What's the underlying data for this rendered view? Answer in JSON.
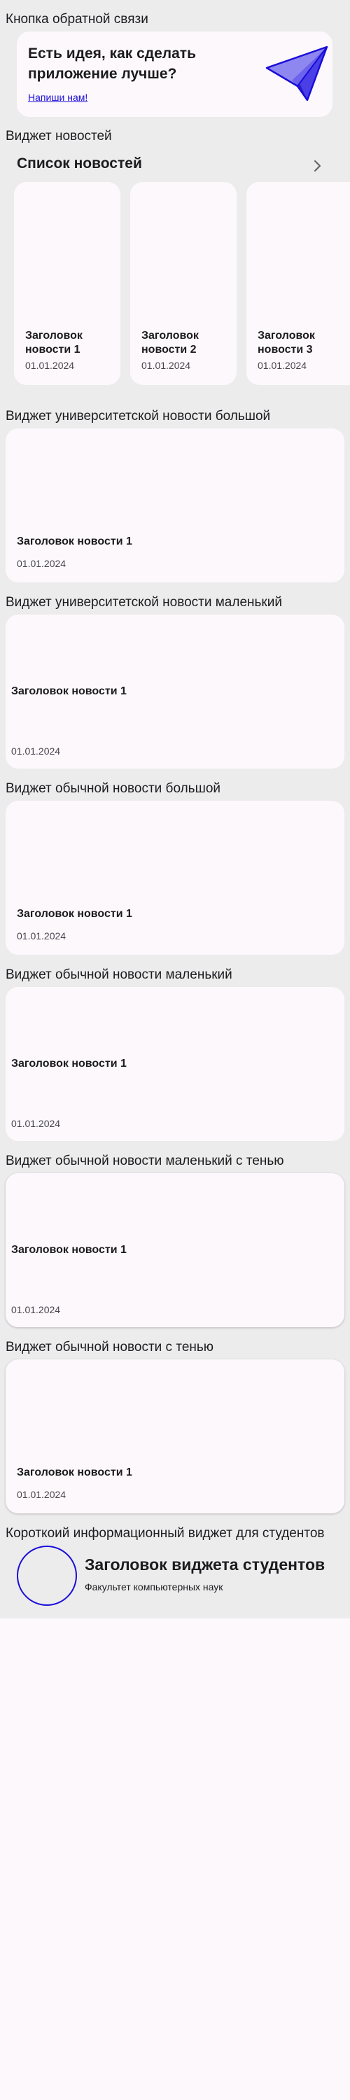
{
  "feedback": {
    "section_title": "Кнопка обратной связи",
    "title": "Есть идея, как сделать приложение лучше?",
    "link": "Напиши нам!",
    "icon": "paper-plane-icon",
    "accent": "#1a0dd9"
  },
  "news_widget": {
    "section_title": "Виджет новостей",
    "list_title": "Список новостей",
    "chevron_icon": "chevron-right-icon",
    "items": [
      {
        "title": "Заголовок новости 1",
        "date": "01.01.2024"
      },
      {
        "title": "Заголовок новости 2",
        "date": "01.01.2024"
      },
      {
        "title": "Заголовок новости 3",
        "date": "01.01.2024"
      }
    ]
  },
  "uni_big": {
    "section_title": "Виджет университетской новости большой",
    "title": "Заголовок новости 1",
    "date": "01.01.2024"
  },
  "uni_small": {
    "section_title": "Виджет университетской новости маленький",
    "title": "Заголовок новости 1",
    "date": "01.01.2024"
  },
  "regular_big": {
    "section_title": "Виджет обычной новости большой",
    "title": "Заголовок новости 1",
    "date": "01.01.2024"
  },
  "regular_small": {
    "section_title": "Виджет обычной новости маленький",
    "title": "Заголовок новости 1",
    "date": "01.01.2024"
  },
  "regular_small_shadow": {
    "section_title": "Виджет обычной новости маленький с тенью",
    "title": "Заголовок новости 1",
    "date": "01.01.2024"
  },
  "regular_shadow": {
    "section_title": "Виджет обычной новости с тенью",
    "title": "Заголовок новости 1",
    "date": "01.01.2024"
  },
  "student_widget": {
    "section_title": "Короткоий информационный виджет для студентов",
    "title": "Заголовок виджета студентов",
    "subtitle": "Факультет компьютерных наук"
  }
}
